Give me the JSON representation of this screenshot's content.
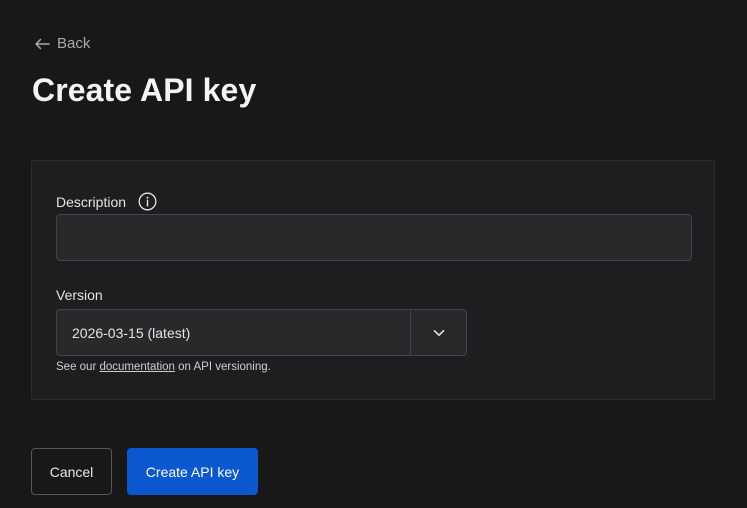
{
  "nav": {
    "back_label": "Back",
    "back_icon": "arrow-left-icon"
  },
  "page": {
    "title": "Create API key"
  },
  "form": {
    "description": {
      "label": "Description",
      "value": "",
      "info_icon": "info-icon"
    },
    "version": {
      "label": "Version",
      "selected": "2026-03-15 (latest)",
      "toggle_icon": "chevron-down-icon"
    },
    "help": {
      "prefix": "See our",
      "link_text": "documentation",
      "suffix": "on API versioning."
    }
  },
  "actions": {
    "cancel_label": "Cancel",
    "create_label": "Create API key"
  },
  "colors": {
    "background": "#181819",
    "card": "#1e1e20",
    "primary_button": "#0b57d0"
  }
}
